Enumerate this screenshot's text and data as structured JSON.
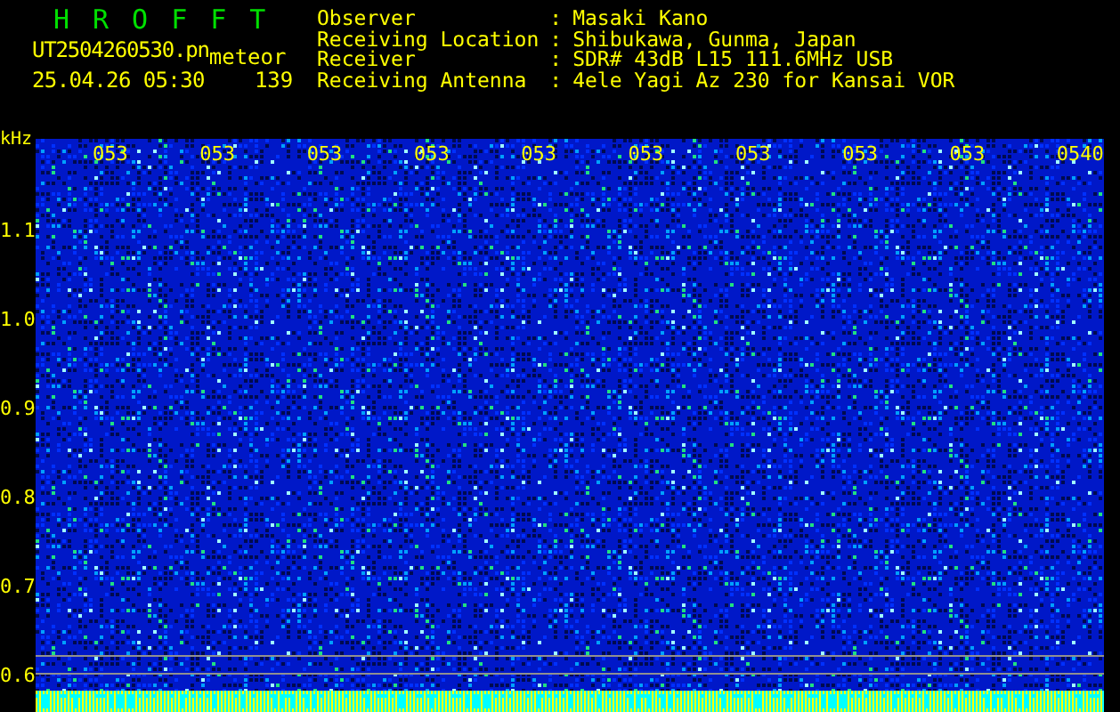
{
  "app": {
    "title": "HROFFT"
  },
  "file": {
    "name": "UT2504260530.pn",
    "tag": "meteor",
    "datetime": "25.04.26 05:30",
    "count": "139"
  },
  "info": [
    {
      "label": "Observer",
      "separator": ":",
      "value": "Masaki Kano"
    },
    {
      "label": "Receiving Location",
      "separator": ":",
      "value": "Shibukawa, Gunma, Japan"
    },
    {
      "label": "Receiver",
      "separator": ":",
      "value": "SDR# 43dB L15 111.6MHz USB"
    },
    {
      "label": "Receiving Antenna",
      "separator": ":",
      "value": "4ele Yagi Az 230 for Kansai VOR"
    }
  ],
  "axis": {
    "unit": "kHz",
    "labels": [
      "1.1",
      "1.0",
      "0.9",
      "0.8",
      "0.7",
      "0.6"
    ]
  },
  "time_labels": [
    "053",
    "053",
    "053",
    "053",
    "053",
    "053",
    "053",
    "053",
    "053",
    "0540"
  ]
}
